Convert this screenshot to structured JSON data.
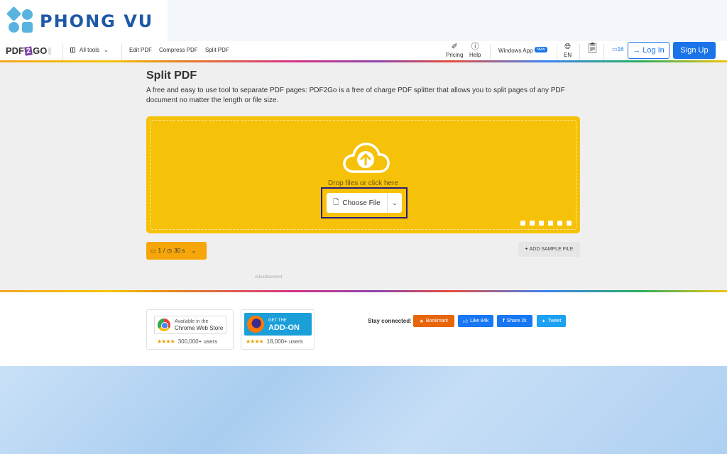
{
  "watermark": {
    "text": "PHONG VU"
  },
  "nav": {
    "brand": {
      "a": "PDF",
      "b": "2",
      "c": "GO"
    },
    "all_tools": "All tools",
    "links": [
      "Edit PDF",
      "Compress PDF",
      "Split PDF"
    ],
    "pricing": "Pricing",
    "help": "Help",
    "windows_app": "Windows App",
    "new_badge": "New",
    "language": "EN",
    "credits": "16",
    "login": "Log In",
    "signup": "Sign Up"
  },
  "main": {
    "title": "Split PDF",
    "description": "A free and easy to use tool to separate PDF pages: PDF2Go is a free of charge PDF splitter that allows you to split pages of any PDF document no matter the length or file size.",
    "drop_text": "Drop files or click here",
    "choose_file": "Choose File",
    "limits": {
      "files": "1",
      "separator": "/",
      "time": "30 s"
    },
    "add_sample": "ADD SAMPLE FILE",
    "advertisement": "Advertisement"
  },
  "footer": {
    "chrome": {
      "line1": "Available in the",
      "line2": "Chrome Web Store",
      "users": "300,000+ users",
      "stars": "★★★★"
    },
    "firefox": {
      "line1": "GET THE",
      "line2": "ADD-ON",
      "users": "18,000+ users",
      "stars": "★★★★"
    },
    "stay_connected": "Stay connected:",
    "bookmark": "Bookmark",
    "like": "Like 84k",
    "share": "Share 2k",
    "tweet": "Tweet"
  },
  "colors": {
    "accent": "#1a73e8",
    "dropzone": "#f6c209",
    "limit_box": "#f6a609",
    "bookmark": "#e8650a",
    "facebook": "#1877f2",
    "twitter": "#1da1f2"
  }
}
